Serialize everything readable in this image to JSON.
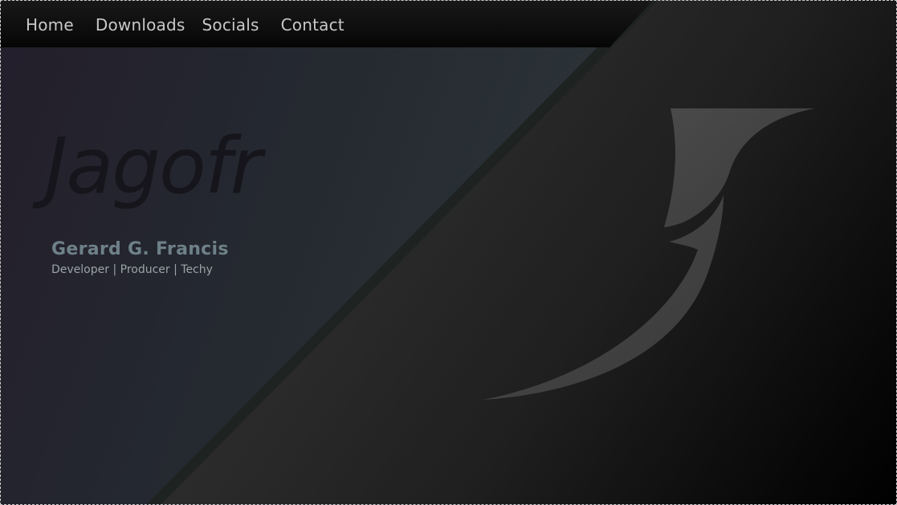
{
  "nav": {
    "items": [
      {
        "label": "Home"
      },
      {
        "label": "Downloads"
      },
      {
        "label": "Socials"
      },
      {
        "label": "Contact"
      }
    ]
  },
  "hero": {
    "brand": "Jagofr",
    "name": "Gerard G. Francis",
    "tagline": "Developer | Producer | Techy"
  },
  "logo": {
    "icon": "j-logo-icon",
    "color": "#3f3f3f"
  },
  "colors": {
    "nav_text": "#c8c8c8",
    "name_text": "#6e8088",
    "brand_text": "#16151b"
  }
}
